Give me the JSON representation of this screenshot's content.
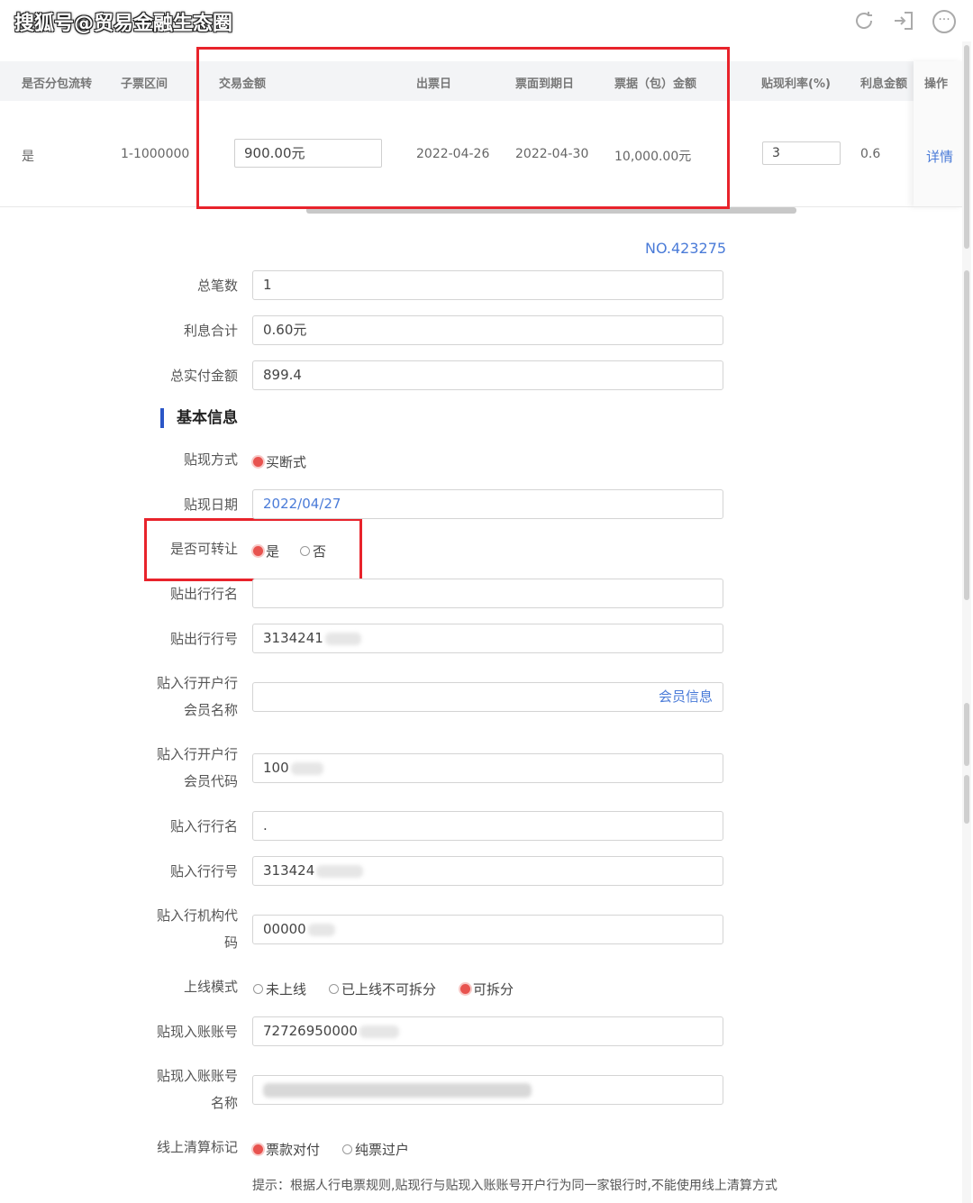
{
  "watermark": "搜狐号@贸易金融生态圈",
  "top_icons": [
    "refresh-icon",
    "exit-icon",
    "more-icon"
  ],
  "table": {
    "headers": [
      "是否分包流转",
      "子票区间",
      "交易金额",
      "出票日",
      "票面到期日",
      "票据（包）金额",
      "贴现利率(%)",
      "利息金额",
      "操作"
    ],
    "row": {
      "split": "是",
      "range": "1-1000000",
      "amount": "900.00元",
      "issue_date": "2022-04-26",
      "due_date": "2022-04-30",
      "bill_amount": "10,000.00元",
      "rate": "3",
      "interest": "0.6",
      "action": "详情"
    }
  },
  "form": {
    "number": "NO.423275",
    "total_count_label": "总笔数",
    "total_count": "1",
    "interest_total_label": "利息合计",
    "interest_total": "0.60元",
    "total_paid_label": "总实付金额",
    "total_paid": "899.4",
    "section_basic": "基本信息",
    "discount_method_label": "贴现方式",
    "discount_method_option": "买断式",
    "discount_date_label": "贴现日期",
    "discount_date": "2022/04/27",
    "transferable_label": "是否可转让",
    "transferable_yes": "是",
    "transferable_no": "否",
    "out_bank_name_label": "贴出行行名",
    "out_bank_name": "",
    "out_bank_no_label": "贴出行行号",
    "out_bank_no": "3134241",
    "in_member_name_label_1": "贴入行开户行",
    "in_member_name_label_2": "会员名称",
    "member_info_link": "会员信息",
    "in_member_code_label_1": "贴入行开户行",
    "in_member_code_label_2": "会员代码",
    "in_member_code": "100",
    "in_bank_name_label": "贴入行行名",
    "in_bank_name": ".",
    "in_bank_no_label": "贴入行行号",
    "in_bank_no": "313424",
    "in_org_code_label_1": "贴入行机构代",
    "in_org_code_label_2": "码",
    "in_org_code": "00000",
    "online_mode_label": "上线模式",
    "online_mode_options": [
      "未上线",
      "已上线不可拆分",
      "可拆分"
    ],
    "account_no_label": "贴现入账账号",
    "account_no": "72726950000",
    "account_name_label_1": "贴现入账账号",
    "account_name_label_2": "名称",
    "clearing_label": "线上清算标记",
    "clearing_options": [
      "票款对付",
      "纯票过户"
    ],
    "tip": "提示：根据人行电票规则,贴现行与贴现入账账号开户行为同一家银行时,不能使用线上清算方式"
  },
  "colors": {
    "highlight": "#e8232b",
    "accent": "#2b56c7",
    "radio_on": "#e8534f",
    "link": "#4a7bd8"
  }
}
